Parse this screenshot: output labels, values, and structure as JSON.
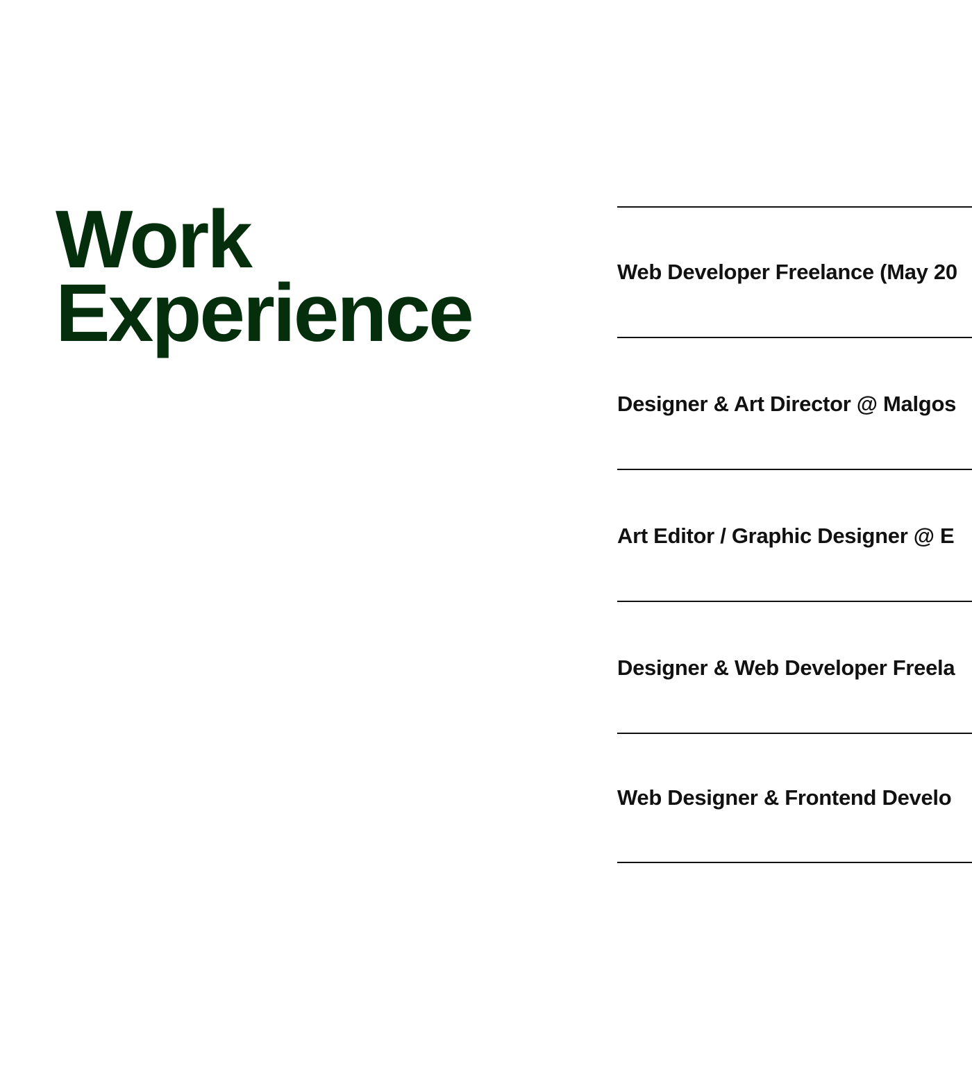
{
  "section": {
    "heading_line1": "Work",
    "heading_line2": "Experience"
  },
  "experience": {
    "items": [
      {
        "label": "Web Developer Freelance (May 20"
      },
      {
        "label": "Designer & Art Director @ Malgos"
      },
      {
        "label": "Art Editor / Graphic Designer @ E"
      },
      {
        "label": "Designer & Web Developer Freela"
      },
      {
        "label": "Web Designer & Frontend Develo"
      }
    ]
  },
  "colors": {
    "heading": "#052f0c",
    "text": "#111111",
    "divider": "#111111",
    "background": "#ffffff"
  }
}
